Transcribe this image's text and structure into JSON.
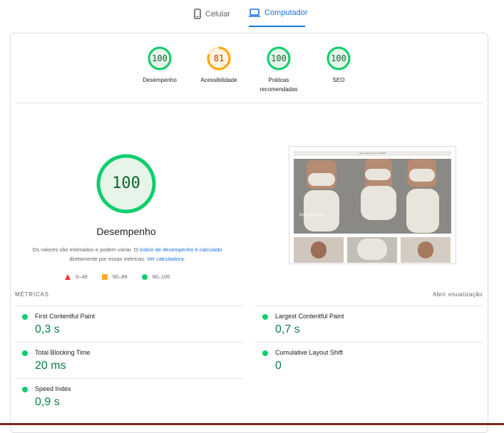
{
  "tabs": [
    {
      "label": "Celular",
      "icon": "smartphone-icon",
      "active": false
    },
    {
      "label": "Computador",
      "icon": "laptop-icon",
      "active": true
    }
  ],
  "scores": [
    {
      "label": "Desempenho",
      "score": "100",
      "fraction": 1.0,
      "color": "#0cce6b"
    },
    {
      "label": "Acessibilidade",
      "score": "81",
      "fraction": 0.81,
      "color": "#ffa400"
    },
    {
      "label": "Práticas recomendadas",
      "score": "100",
      "fraction": 1.0,
      "color": "#0cce6b"
    },
    {
      "label": "SEO",
      "score": "100",
      "fraction": 1.0,
      "color": "#0cce6b"
    }
  ],
  "performance": {
    "score": "100",
    "title": "Desempenho",
    "desc_part1": "Os valores são estimados e podem variar. O ",
    "desc_link1": "índice de desempenho é calculado",
    "desc_part2": " diretamente por essas métricas. ",
    "desc_link2": "Ver calculadora."
  },
  "legend": [
    {
      "range": "0–49",
      "shape": "triangle",
      "color": "#ff3333"
    },
    {
      "range": "50–89",
      "shape": "square",
      "color": "#ffaa33"
    },
    {
      "range": "90–100",
      "shape": "circle",
      "color": "#0cce6b"
    }
  ],
  "screenshot": {
    "banner_text": "frete grátis acima de R$299",
    "hero_text": "Primeira drop"
  },
  "metrics_header": {
    "title": "MÉTRICAS",
    "action": "Abrir visualização"
  },
  "metrics": [
    {
      "name": "First Contentful Paint",
      "value": "0,3 s"
    },
    {
      "name": "Largest Contentful Paint",
      "value": "0,7 s"
    },
    {
      "name": "Total Blocking Time",
      "value": "20 ms"
    },
    {
      "name": "Cumulative Layout Shift",
      "value": "0"
    },
    {
      "name": "Speed Index",
      "value": "0,9 s"
    }
  ]
}
